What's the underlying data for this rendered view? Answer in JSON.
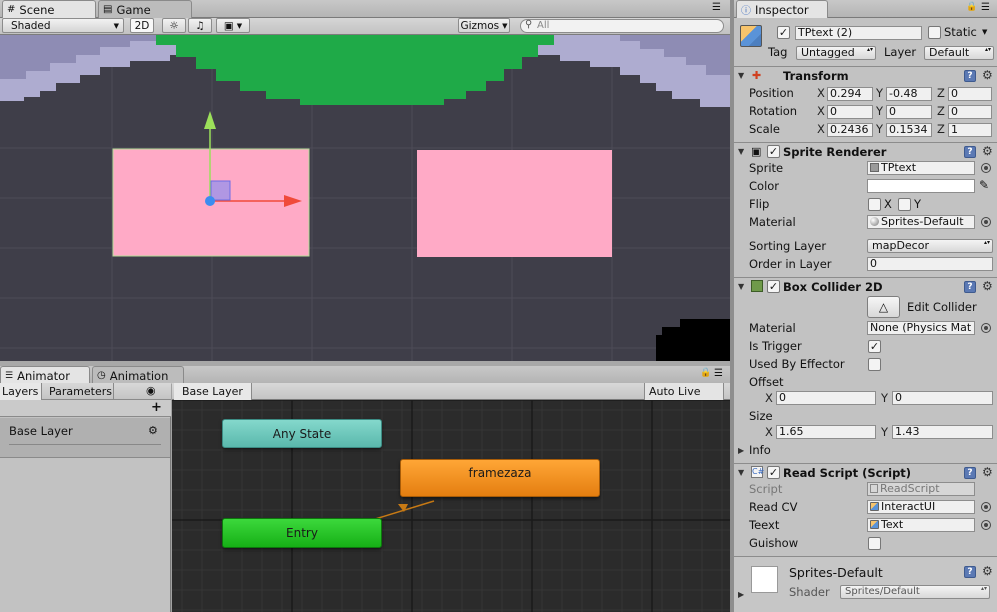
{
  "scene": {
    "tab_scene": "Scene",
    "tab_game": "Game",
    "toolbar": {
      "shading": "Shaded",
      "mode_2d": "2D",
      "gizmos": "Gizmos",
      "search_placeholder": "All"
    }
  },
  "animator": {
    "tab_animator": "Animator",
    "tab_animation": "Animation",
    "layers_tab": "Layers",
    "parameters_tab": "Parameters",
    "layer_name": "Base Layer",
    "breadcrumb": "Base Layer",
    "auto_live_link": "Auto Live Link",
    "add": "+",
    "states": {
      "any_state": "Any State",
      "framezaza": "framezaza",
      "entry": "Entry"
    }
  },
  "inspector": {
    "tab": "Inspector",
    "object_name": "TPtext (2)",
    "static_label": "Static",
    "tag_label": "Tag",
    "tag_value": "Untagged",
    "layer_label": "Layer",
    "layer_value": "Default",
    "transform": {
      "title": "Transform",
      "position_label": "Position",
      "position": {
        "x": "0.294",
        "y": "-0.48",
        "z": "0"
      },
      "rotation_label": "Rotation",
      "rotation": {
        "x": "0",
        "y": "0",
        "z": "0"
      },
      "scale_label": "Scale",
      "scale": {
        "x": "0.2436",
        "y": "0.1534",
        "z": "1"
      }
    },
    "sprite_renderer": {
      "title": "Sprite Renderer",
      "sprite_label": "Sprite",
      "sprite_value": "TPtext",
      "color_label": "Color",
      "flip_label": "Flip",
      "flip_x": "X",
      "flip_y": "Y",
      "material_label": "Material",
      "material_value": "Sprites-Default",
      "sorting_layer_label": "Sorting Layer",
      "sorting_layer_value": "mapDecor",
      "order_label": "Order in Layer",
      "order_value": "0"
    },
    "box_collider": {
      "title": "Box Collider 2D",
      "edit_collider": "Edit Collider",
      "material_label": "Material",
      "material_value": "None (Physics Mat",
      "is_trigger_label": "Is Trigger",
      "used_by_effector_label": "Used By Effector",
      "offset_label": "Offset",
      "offset": {
        "x": "0",
        "y": "0"
      },
      "size_label": "Size",
      "size": {
        "x": "1.65",
        "y": "1.43"
      },
      "info_label": "Info"
    },
    "read_script": {
      "title": "Read Script (Script)",
      "script_label": "Script",
      "script_value": "ReadScript",
      "read_cv_label": "Read CV",
      "read_cv_value": "InteractUI",
      "teext_label": "Teext",
      "teext_value": "Text",
      "guishow_label": "Guishow"
    },
    "material_preview": {
      "name": "Sprites-Default",
      "shader_label": "Shader",
      "shader_value": "Sprites/Default"
    },
    "axis": {
      "x": "X",
      "y": "Y",
      "z": "Z"
    }
  },
  "colors": {
    "scene_bg": "#3f3e49",
    "green": "#1faa48",
    "pink": "#ffaac6",
    "any_state": "#6ec8be",
    "framezaza": "#f08c1a",
    "entry": "#1fbe1f"
  }
}
